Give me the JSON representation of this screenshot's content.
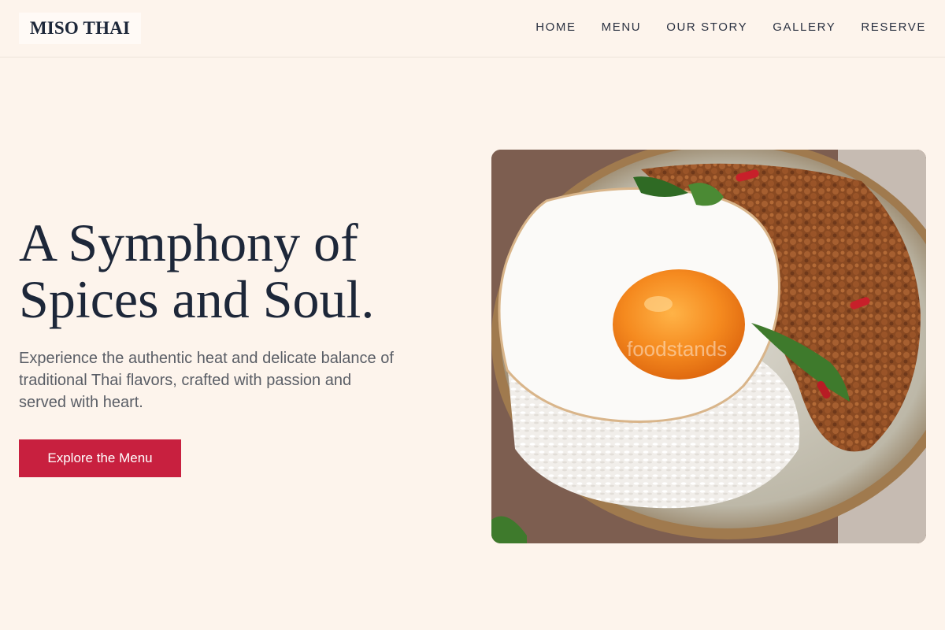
{
  "brand": {
    "name": "MISO THAI"
  },
  "nav": {
    "items": [
      {
        "label": "HOME"
      },
      {
        "label": "MENU"
      },
      {
        "label": "OUR STORY"
      },
      {
        "label": "GALLERY"
      },
      {
        "label": "RESERVE"
      }
    ]
  },
  "hero": {
    "title_line1": "A Symphony of",
    "title_line2": "Spices and Soul.",
    "subtitle": "Experience the authentic heat and delicate balance of traditional Thai flavors, crafted with passion and served with heart.",
    "cta_label": "Explore the Menu",
    "image": {
      "subject": "fried-egg-with-rice-and-basil-pork-plate",
      "watermark": "foodstands"
    }
  },
  "colors": {
    "background": "#fdf4ec",
    "text_dark": "#1d2739",
    "accent": "#c8203f"
  }
}
